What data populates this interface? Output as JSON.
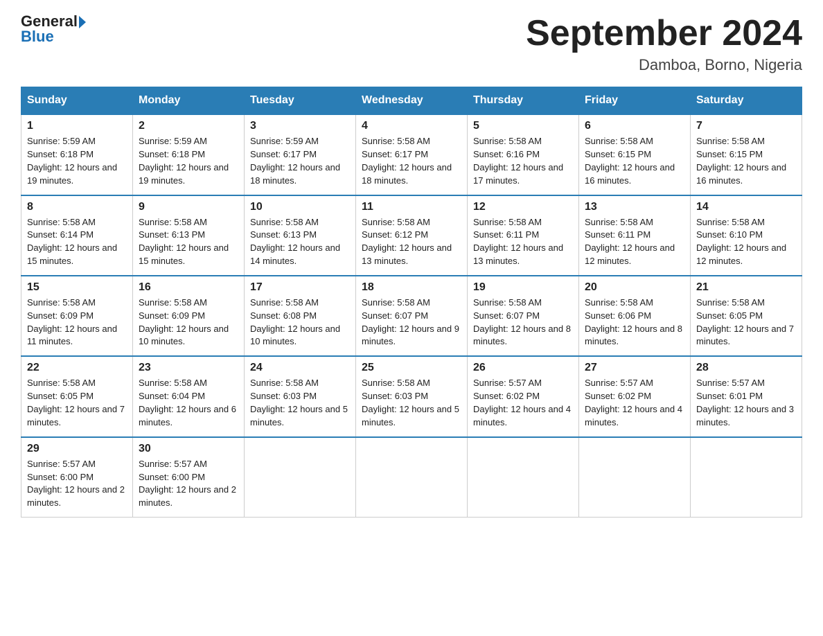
{
  "header": {
    "logo_line1": "General",
    "logo_line2": "Blue",
    "month_title": "September 2024",
    "location": "Damboa, Borno, Nigeria"
  },
  "weekdays": [
    "Sunday",
    "Monday",
    "Tuesday",
    "Wednesday",
    "Thursday",
    "Friday",
    "Saturday"
  ],
  "weeks": [
    [
      {
        "day": "1",
        "sunrise": "5:59 AM",
        "sunset": "6:18 PM",
        "daylight": "12 hours and 19 minutes."
      },
      {
        "day": "2",
        "sunrise": "5:59 AM",
        "sunset": "6:18 PM",
        "daylight": "12 hours and 19 minutes."
      },
      {
        "day": "3",
        "sunrise": "5:59 AM",
        "sunset": "6:17 PM",
        "daylight": "12 hours and 18 minutes."
      },
      {
        "day": "4",
        "sunrise": "5:58 AM",
        "sunset": "6:17 PM",
        "daylight": "12 hours and 18 minutes."
      },
      {
        "day": "5",
        "sunrise": "5:58 AM",
        "sunset": "6:16 PM",
        "daylight": "12 hours and 17 minutes."
      },
      {
        "day": "6",
        "sunrise": "5:58 AM",
        "sunset": "6:15 PM",
        "daylight": "12 hours and 16 minutes."
      },
      {
        "day": "7",
        "sunrise": "5:58 AM",
        "sunset": "6:15 PM",
        "daylight": "12 hours and 16 minutes."
      }
    ],
    [
      {
        "day": "8",
        "sunrise": "5:58 AM",
        "sunset": "6:14 PM",
        "daylight": "12 hours and 15 minutes."
      },
      {
        "day": "9",
        "sunrise": "5:58 AM",
        "sunset": "6:13 PM",
        "daylight": "12 hours and 15 minutes."
      },
      {
        "day": "10",
        "sunrise": "5:58 AM",
        "sunset": "6:13 PM",
        "daylight": "12 hours and 14 minutes."
      },
      {
        "day": "11",
        "sunrise": "5:58 AM",
        "sunset": "6:12 PM",
        "daylight": "12 hours and 13 minutes."
      },
      {
        "day": "12",
        "sunrise": "5:58 AM",
        "sunset": "6:11 PM",
        "daylight": "12 hours and 13 minutes."
      },
      {
        "day": "13",
        "sunrise": "5:58 AM",
        "sunset": "6:11 PM",
        "daylight": "12 hours and 12 minutes."
      },
      {
        "day": "14",
        "sunrise": "5:58 AM",
        "sunset": "6:10 PM",
        "daylight": "12 hours and 12 minutes."
      }
    ],
    [
      {
        "day": "15",
        "sunrise": "5:58 AM",
        "sunset": "6:09 PM",
        "daylight": "12 hours and 11 minutes."
      },
      {
        "day": "16",
        "sunrise": "5:58 AM",
        "sunset": "6:09 PM",
        "daylight": "12 hours and 10 minutes."
      },
      {
        "day": "17",
        "sunrise": "5:58 AM",
        "sunset": "6:08 PM",
        "daylight": "12 hours and 10 minutes."
      },
      {
        "day": "18",
        "sunrise": "5:58 AM",
        "sunset": "6:07 PM",
        "daylight": "12 hours and 9 minutes."
      },
      {
        "day": "19",
        "sunrise": "5:58 AM",
        "sunset": "6:07 PM",
        "daylight": "12 hours and 8 minutes."
      },
      {
        "day": "20",
        "sunrise": "5:58 AM",
        "sunset": "6:06 PM",
        "daylight": "12 hours and 8 minutes."
      },
      {
        "day": "21",
        "sunrise": "5:58 AM",
        "sunset": "6:05 PM",
        "daylight": "12 hours and 7 minutes."
      }
    ],
    [
      {
        "day": "22",
        "sunrise": "5:58 AM",
        "sunset": "6:05 PM",
        "daylight": "12 hours and 7 minutes."
      },
      {
        "day": "23",
        "sunrise": "5:58 AM",
        "sunset": "6:04 PM",
        "daylight": "12 hours and 6 minutes."
      },
      {
        "day": "24",
        "sunrise": "5:58 AM",
        "sunset": "6:03 PM",
        "daylight": "12 hours and 5 minutes."
      },
      {
        "day": "25",
        "sunrise": "5:58 AM",
        "sunset": "6:03 PM",
        "daylight": "12 hours and 5 minutes."
      },
      {
        "day": "26",
        "sunrise": "5:57 AM",
        "sunset": "6:02 PM",
        "daylight": "12 hours and 4 minutes."
      },
      {
        "day": "27",
        "sunrise": "5:57 AM",
        "sunset": "6:02 PM",
        "daylight": "12 hours and 4 minutes."
      },
      {
        "day": "28",
        "sunrise": "5:57 AM",
        "sunset": "6:01 PM",
        "daylight": "12 hours and 3 minutes."
      }
    ],
    [
      {
        "day": "29",
        "sunrise": "5:57 AM",
        "sunset": "6:00 PM",
        "daylight": "12 hours and 2 minutes."
      },
      {
        "day": "30",
        "sunrise": "5:57 AM",
        "sunset": "6:00 PM",
        "daylight": "12 hours and 2 minutes."
      },
      null,
      null,
      null,
      null,
      null
    ]
  ],
  "labels": {
    "sunrise_prefix": "Sunrise: ",
    "sunset_prefix": "Sunset: ",
    "daylight_prefix": "Daylight: "
  }
}
